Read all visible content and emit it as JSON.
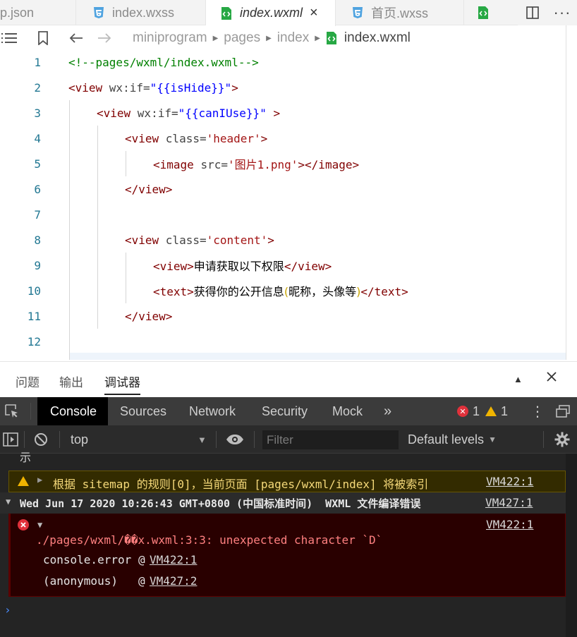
{
  "editor_tabs": [
    {
      "label": "p.json",
      "icon": "json-file-icon"
    },
    {
      "label": "index.wxss",
      "icon": "css-file-icon"
    },
    {
      "label": "index.wxml",
      "icon": "wxml-file-icon",
      "active": true,
      "close": "×"
    },
    {
      "label": "首页.wxss",
      "icon": "css-file-icon"
    }
  ],
  "breadcrumb": [
    "miniprogram",
    "pages",
    "index",
    "index.wxml"
  ],
  "code_lines": [
    {
      "n": "1",
      "text": "<!--pages/wxml/index.wxml-->"
    },
    {
      "n": "2",
      "parts": [
        "<view ",
        "wx:if=",
        "\"{{isHide}}\"",
        ">"
      ]
    },
    {
      "n": "3",
      "parts": [
        "<view ",
        "wx:if=",
        "\"{{canIUse}}\"",
        " >"
      ]
    },
    {
      "n": "4",
      "parts": [
        "<view ",
        "class=",
        "'header'",
        ">"
      ]
    },
    {
      "n": "5",
      "parts": [
        "<image ",
        "src=",
        "'图片1.png'",
        "></image>"
      ]
    },
    {
      "n": "6",
      "text": "</view>"
    },
    {
      "n": "7",
      "text": ""
    },
    {
      "n": "8",
      "parts": [
        "<view ",
        "class=",
        "'content'",
        ">"
      ]
    },
    {
      "n": "9",
      "parts": [
        "<view>",
        "申请获取以下权限",
        "</view>"
      ]
    },
    {
      "n": "10",
      "parts": [
        "<text>",
        "获得你的公开信息",
        "(",
        "昵称，头像等",
        ")",
        "</text>"
      ]
    },
    {
      "n": "11",
      "text": "</view>"
    },
    {
      "n": "12",
      "text": ""
    }
  ],
  "panel_tabs": [
    "问题",
    "输出",
    "调试器"
  ],
  "devtools_tabs": [
    "Console",
    "Sources",
    "Network",
    "Security",
    "Mock"
  ],
  "devtools_more": "»",
  "counts": {
    "errors": "1",
    "warnings": "1"
  },
  "console_toolbar": {
    "context": "top",
    "filter_placeholder": "Filter",
    "levels": "Default levels"
  },
  "console": {
    "clipped": "示",
    "warning": {
      "text": "根据 sitemap 的规则[0]，当前页面 [pages/wxml/index] 将被索引",
      "source": "VM422:1"
    },
    "group": {
      "text": "Wed Jun 17 2020 10:26:43 GMT+0800 (中国标准时间)  WXML 文件编译错误",
      "source": "VM427:1"
    },
    "error": {
      "source": "VM422:1",
      "message": "./pages/wxml/��x.wxml:3:3: unexpected character `D`",
      "stack": [
        {
          "fn": "console.error",
          "at": "@",
          "loc": "VM422:1"
        },
        {
          "fn": "(anonymous)",
          "at": "@",
          "loc": "VM427:2"
        }
      ]
    },
    "prompt": "›"
  }
}
